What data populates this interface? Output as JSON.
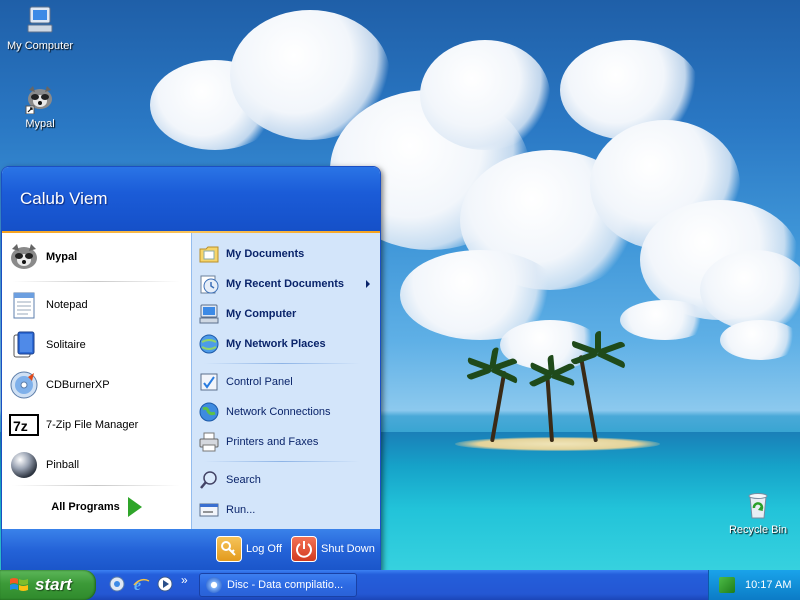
{
  "desktop": {
    "icons": [
      {
        "label": "My Computer",
        "icon": "computer-icon"
      },
      {
        "label": "Mypal",
        "icon": "raccoon-icon"
      },
      {
        "label": "Recycle Bin",
        "icon": "recycle-bin-icon"
      }
    ]
  },
  "start_menu": {
    "user_name": "Calub Viem",
    "pinned": [
      {
        "label": "Mypal",
        "icon": "raccoon-icon"
      }
    ],
    "recent": [
      {
        "label": "Notepad",
        "icon": "notepad-icon"
      },
      {
        "label": "Solitaire",
        "icon": "solitaire-icon"
      },
      {
        "label": "CDBurnerXP",
        "icon": "cd-icon"
      },
      {
        "label": "7-Zip File Manager",
        "icon": "7zip-icon"
      },
      {
        "label": "Pinball",
        "icon": "pinball-icon"
      }
    ],
    "all_programs_label": "All Programs",
    "places": [
      {
        "label": "My Documents",
        "icon": "folder-icon"
      },
      {
        "label": "My Recent Documents",
        "icon": "recent-documents-icon"
      },
      {
        "label": "My Computer",
        "icon": "computer-icon"
      },
      {
        "label": "My Network Places",
        "icon": "network-icon"
      }
    ],
    "settings": [
      {
        "label": "Control Panel",
        "icon": "control-panel-icon"
      },
      {
        "label": "Network Connections",
        "icon": "globe-icon"
      },
      {
        "label": "Printers and Faxes",
        "icon": "printer-icon"
      }
    ],
    "tools": [
      {
        "label": "Search",
        "icon": "search-icon"
      },
      {
        "label": "Run...",
        "icon": "run-icon"
      }
    ],
    "log_off_label": "Log Off",
    "shut_down_label": "Shut Down"
  },
  "taskbar": {
    "start_label": "start",
    "quick_launch": [
      {
        "icon": "windows-media-icon"
      },
      {
        "icon": "internet-explorer-icon"
      },
      {
        "icon": "media-player-icon"
      }
    ],
    "chevron": "»",
    "task_button_label": "Disc - Data compilatio...",
    "clock": "10:17 AM"
  },
  "colors": {
    "start_menu_header": "#1b5cd8",
    "start_button": "#3c9a38",
    "taskbar": "#245edb",
    "tray": "#1290d8",
    "right_pane": "#d3e5fa"
  }
}
